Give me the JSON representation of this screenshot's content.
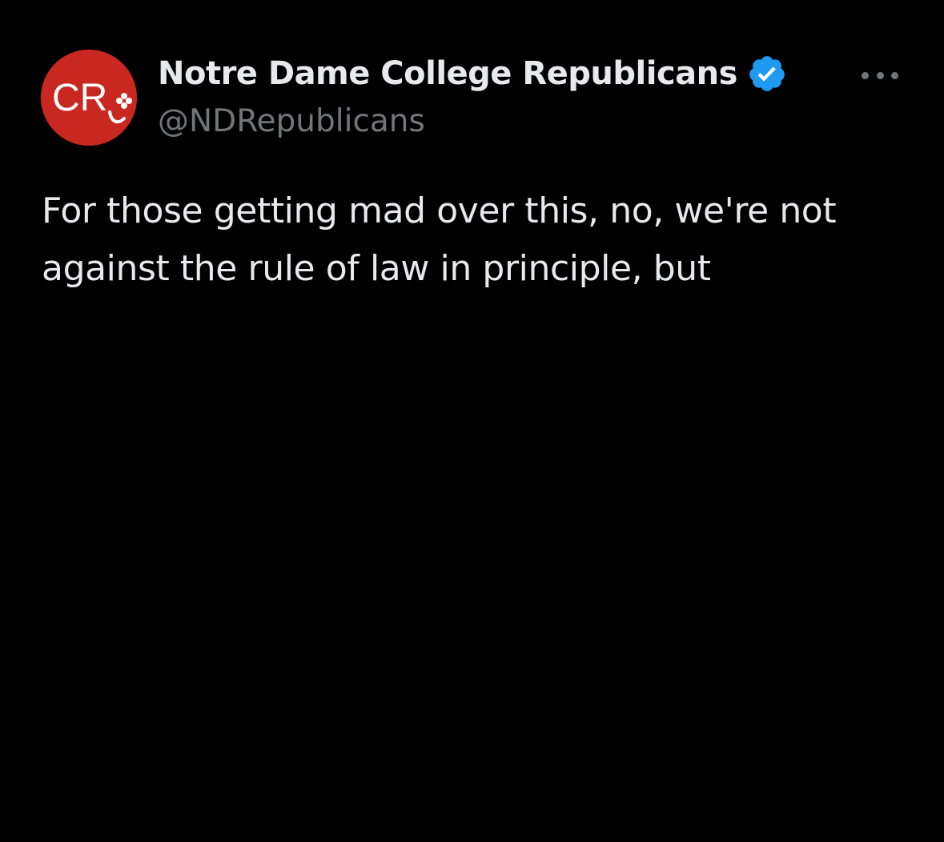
{
  "author": {
    "display_name": "Notre Dame College Republicans",
    "handle": "@NDRepublicans",
    "avatar_text": "CR",
    "verified": true
  },
  "tweet": {
    "text": "For those getting mad over this, no, we're not against the rule of law in principle, but"
  },
  "icons": {
    "avatar": "cr-logo-icon",
    "verified": "verified-badge-icon",
    "more": "more-options-icon"
  },
  "colors": {
    "background": "#000000",
    "text_primary": "#e7e9ea",
    "text_secondary": "#71767b",
    "avatar_bg": "#c8281f",
    "verified_blue": "#1d9bf0"
  }
}
